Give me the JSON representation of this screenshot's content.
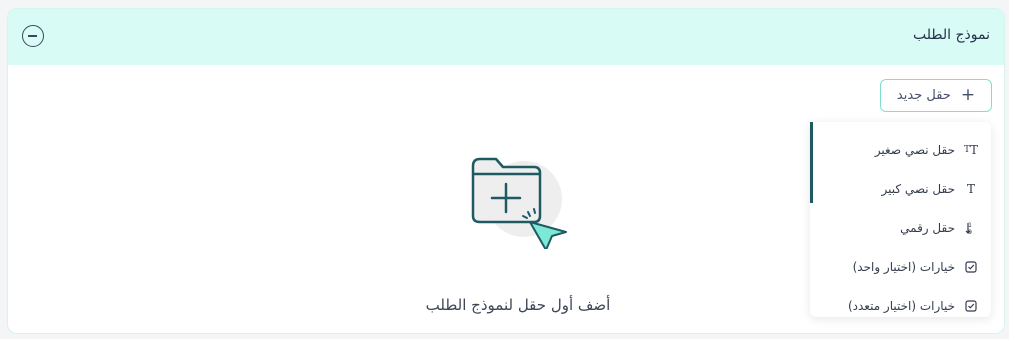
{
  "panel": {
    "title": "نموذج الطلب",
    "collapse_icon": "minus-circle-icon"
  },
  "toolbar": {
    "new_field_label": "حقل جديد",
    "new_field_icon": "plus-icon"
  },
  "empty_state": {
    "message": "أضف أول حقل لنموذج الطلب",
    "illustration": "folder-add-cursor-illustration"
  },
  "dropdown": {
    "items": [
      {
        "label": "حقل نصي صغير",
        "icon": "small-text-icon"
      },
      {
        "label": "حقل نصي كبير",
        "icon": "large-text-icon"
      },
      {
        "label": "حقل رقمي",
        "icon": "numeric-icon"
      },
      {
        "label": "خيارات (اختيار واحد)",
        "icon": "checkbox-icon"
      },
      {
        "label": "خيارات (اختيار متعدد)",
        "icon": "checkbox-icon"
      }
    ]
  },
  "colors": {
    "header_bg": "#d9fbf5",
    "accent": "#1f5a63",
    "button_border": "#7fe0cf"
  }
}
